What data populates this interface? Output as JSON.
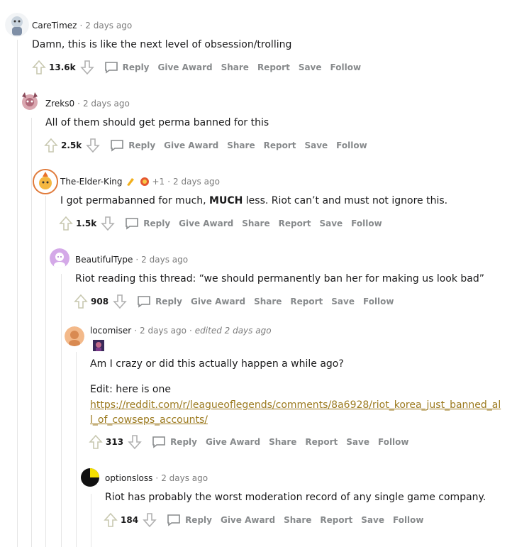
{
  "comments": [
    {
      "author": "CareTimez",
      "time": "2 days ago",
      "text": "Damn, this is like the next level of obsession/trolling",
      "score": "13.6k"
    },
    {
      "author": "Zreks0",
      "time": "2 days ago",
      "text": "All of them should get perma banned for this",
      "score": "2.5k"
    },
    {
      "author": "The-Elder-King",
      "extra": "+1",
      "time": "2 days ago",
      "text_pre": "I got permabanned for much, ",
      "text_bold": "MUCH",
      "text_post": " less. Riot can’t and must not ignore this.",
      "score": "1.5k"
    },
    {
      "author": "BeautifulType",
      "time": "2 days ago",
      "text": "Riot reading this thread: “we should permanently ban her for making us look bad”",
      "score": "908"
    },
    {
      "author": "locomiser",
      "time": "2 days ago",
      "edited": "edited 2 days ago",
      "text": "Am I crazy or did this actually happen a while ago?",
      "text2": "Edit: here is one",
      "link": "https://reddit.com/r/leagueoflegends/comments/8a6928/riot_korea_just_banned_all_of_cowseps_accounts/",
      "score": "313"
    },
    {
      "author": "optionsloss",
      "time": "2 days ago",
      "text": "Riot has probably the worst moderation record of any single game company.",
      "score": "184"
    }
  ],
  "actions": {
    "reply": "Reply",
    "award": "Give Award",
    "share": "Share",
    "report": "Report",
    "save": "Save",
    "follow": "Follow"
  },
  "colors": {
    "link": "#9c7a1f",
    "muted": "#878a8c",
    "thread": "#e5e5e5"
  }
}
